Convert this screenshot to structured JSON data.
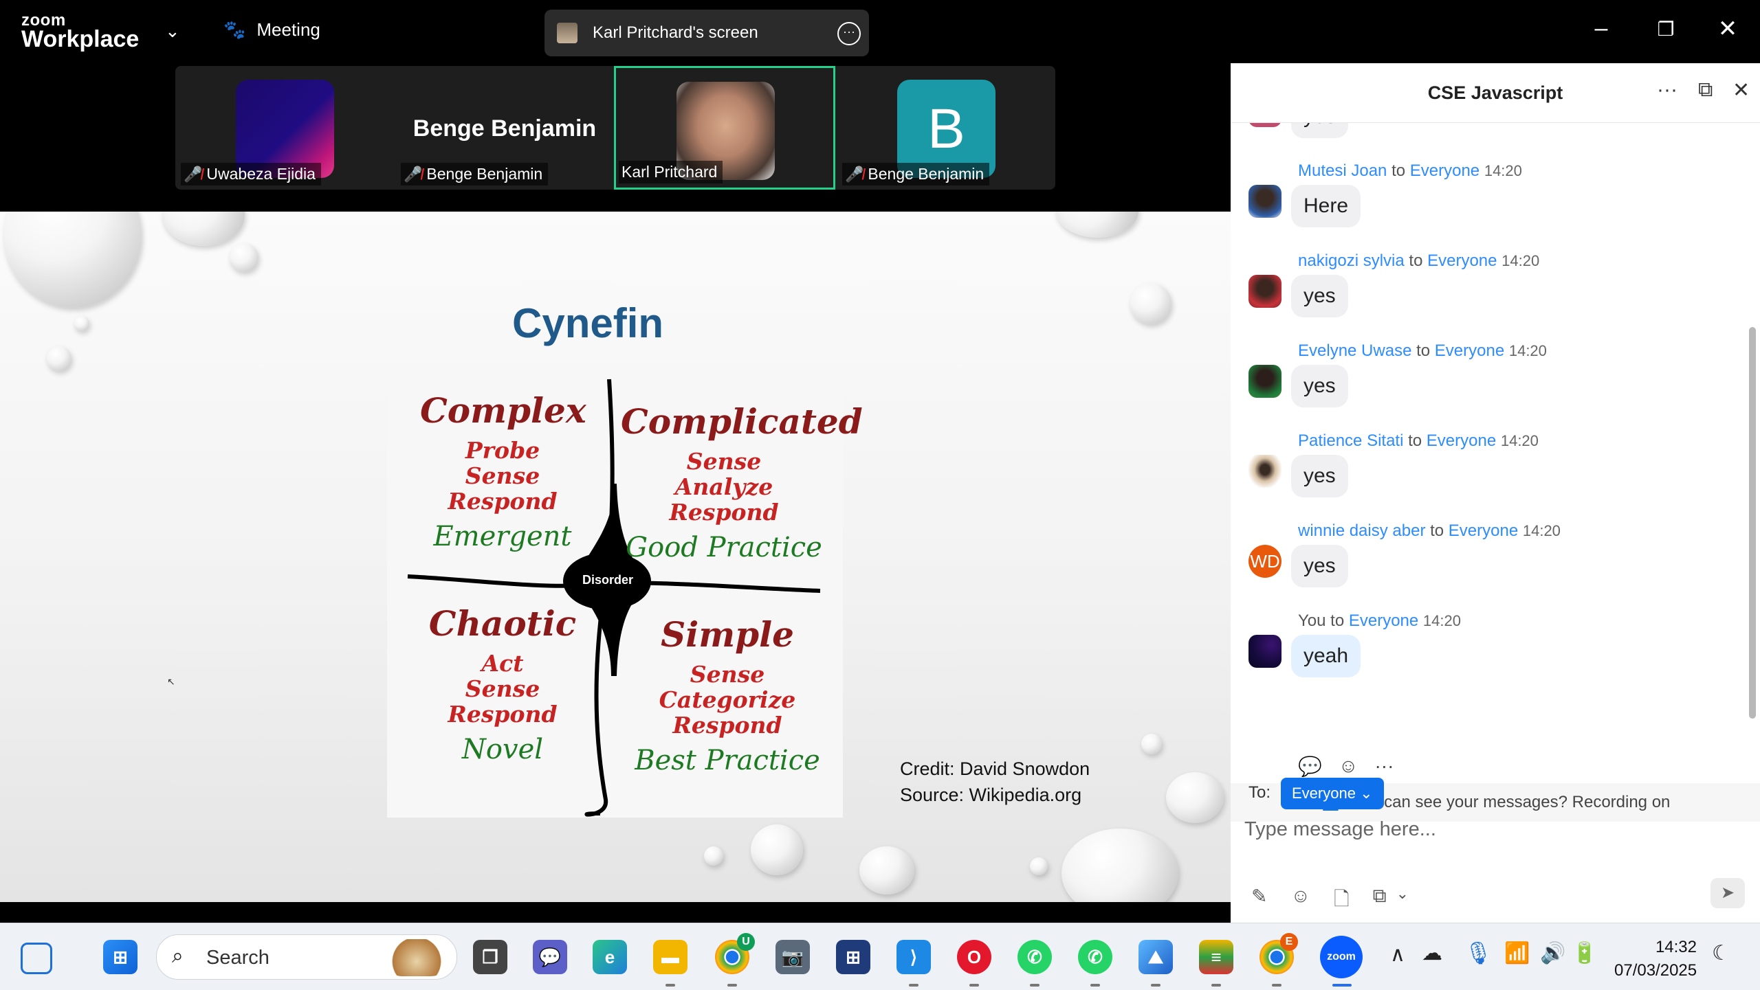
{
  "titlebar": {
    "logo_top": "zoom",
    "logo_bottom": "Workplace",
    "meeting_label": "Meeting",
    "screen_share_label": "Karl Pritchard's screen"
  },
  "gallery": {
    "tiles": [
      {
        "name": "Uwabeza Ejidia",
        "muted": true
      },
      {
        "name": "Benge Benjamin",
        "display": "Benge Benjamin",
        "muted": true
      },
      {
        "name": "Karl Pritchard",
        "muted": false,
        "active_speaker": true
      },
      {
        "name": "Benge Benjamin",
        "initial": "B",
        "muted": true
      }
    ]
  },
  "slide": {
    "title": "Cynefin",
    "quadrants": {
      "complex": {
        "head": "Complex",
        "steps": [
          "Probe",
          "Sense",
          "Respond"
        ],
        "practice": "Emergent"
      },
      "complicated": {
        "head": "Complicated",
        "steps": [
          "Sense",
          "Analyze",
          "Respond"
        ],
        "practice": "Good Practice"
      },
      "chaotic": {
        "head": "Chaotic",
        "steps": [
          "Act",
          "Sense",
          "Respond"
        ],
        "practice": "Novel"
      },
      "simple": {
        "head": "Simple",
        "steps": [
          "Sense",
          "Categorize",
          "Respond"
        ],
        "practice": "Best Practice"
      }
    },
    "center_label": "Disorder",
    "credit_line1": "Credit: David Snowdon",
    "credit_line2": "Source:  Wikipedia.org"
  },
  "chat": {
    "title": "CSE Javascript",
    "partial_top_message": "yes",
    "messages": [
      {
        "sender": "Mutesi Joan",
        "to": "to",
        "recipient": "Everyone",
        "time": "14:20",
        "text": "Here"
      },
      {
        "sender": "nakigozi sylvia",
        "to": "to",
        "recipient": "Everyone",
        "time": "14:20",
        "text": "yes"
      },
      {
        "sender": "Evelyne Uwase",
        "to": "to",
        "recipient": "Everyone",
        "time": "14:20",
        "text": "yes"
      },
      {
        "sender": "Patience Sitati",
        "to": "to",
        "recipient": "Everyone",
        "time": "14:20",
        "text": "yes"
      },
      {
        "sender": "winnie daisy aber",
        "to": "to",
        "recipient": "Everyone",
        "time": "14:20",
        "text": "yes",
        "initials": "WD"
      },
      {
        "sender": "You",
        "to": "to",
        "recipient": "Everyone",
        "time": "14:20",
        "text": "yeah"
      }
    ],
    "notice": "Who can see your messages? Recording on",
    "to_label": "To:",
    "recipient_select": "Everyone",
    "input_placeholder": "Type message here..."
  },
  "taskbar": {
    "search_label": "Search",
    "time": "14:32",
    "date": "07/03/2025",
    "badges": {
      "chrome1": "U",
      "chrome2": "E"
    },
    "zoom_label": "zoom"
  },
  "colors": {
    "zoom_blue": "#0e71eb",
    "link_blue": "#2d8cff",
    "speaker_green": "#23d18b",
    "slide_title": "#1f5a8a"
  }
}
